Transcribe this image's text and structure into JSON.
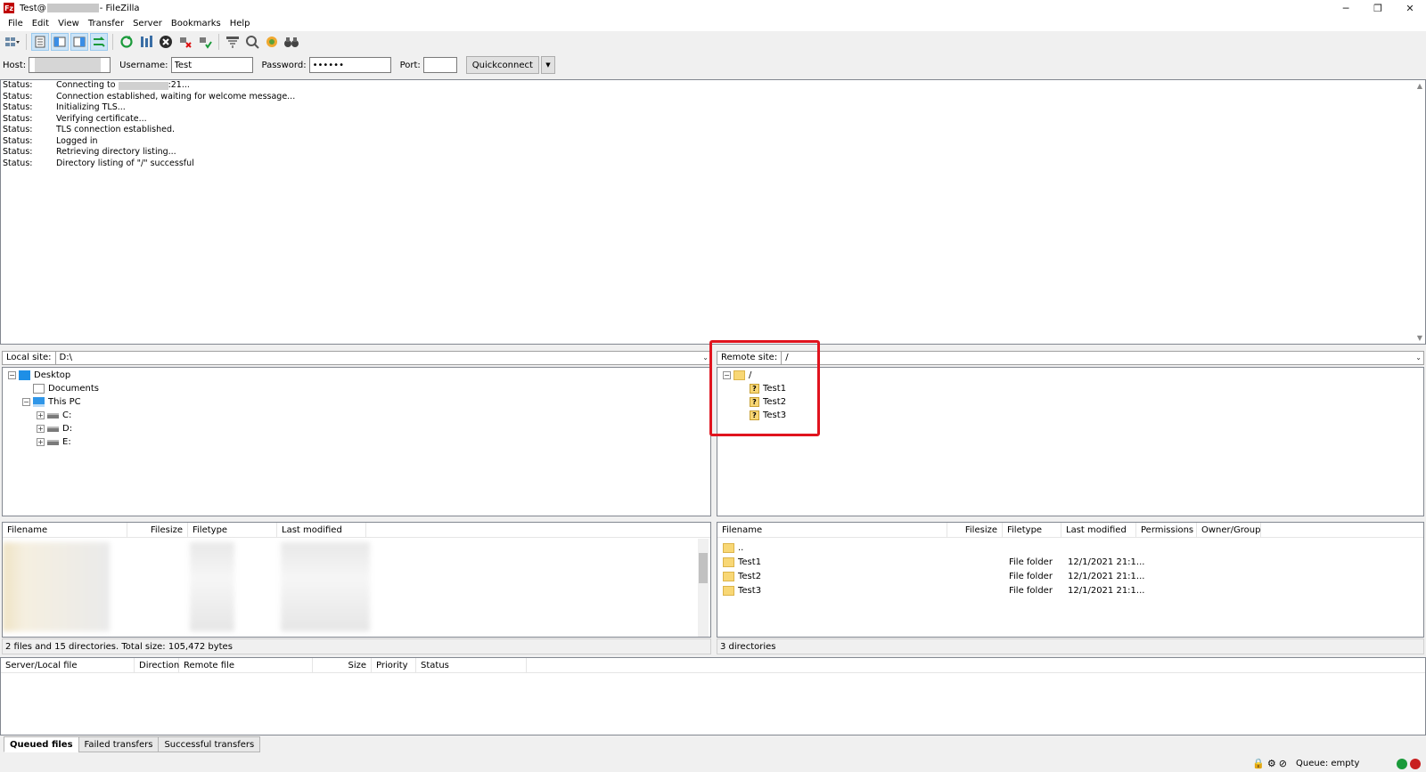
{
  "window": {
    "title_prefix": "Test@",
    "title_suffix": "- FileZilla",
    "app_logo": "Fz",
    "controls": [
      "─",
      "❐",
      "✕"
    ]
  },
  "menu": [
    "File",
    "Edit",
    "View",
    "Transfer",
    "Server",
    "Bookmarks",
    "Help"
  ],
  "quickconnect": {
    "host_label": "Host:",
    "host_value": "",
    "username_label": "Username:",
    "username_value": "Test",
    "password_label": "Password:",
    "password_value": "••••••",
    "port_label": "Port:",
    "port_value": "",
    "button_label": "Quickconnect"
  },
  "log": [
    {
      "type": "Status:",
      "message": "Connecting to",
      "tail": ":21..."
    },
    {
      "type": "Status:",
      "message": "Connection established, waiting for welcome message..."
    },
    {
      "type": "Status:",
      "message": "Initializing TLS..."
    },
    {
      "type": "Status:",
      "message": "Verifying certificate..."
    },
    {
      "type": "Status:",
      "message": "TLS connection established."
    },
    {
      "type": "Status:",
      "message": "Logged in"
    },
    {
      "type": "Status:",
      "message": "Retrieving directory listing..."
    },
    {
      "type": "Status:",
      "message": "Directory listing of \"/\" successful"
    }
  ],
  "local": {
    "site_label": "Local site:",
    "path": "D:\\",
    "tree": [
      {
        "label": "Desktop",
        "icon": "desktop-icon",
        "level": 0,
        "expander": "−"
      },
      {
        "label": "Documents",
        "icon": "document-icon",
        "level": 1,
        "expander": ""
      },
      {
        "label": "This PC",
        "icon": "computer-icon",
        "level": 1,
        "expander": "−"
      },
      {
        "label": "C:",
        "icon": "drive-icon",
        "level": 2,
        "expander": "+"
      },
      {
        "label": "D:",
        "icon": "drive-icon",
        "level": 2,
        "expander": "+"
      },
      {
        "label": "E:",
        "icon": "drive-icon",
        "level": 2,
        "expander": "+"
      }
    ],
    "columns": [
      "Filename",
      "Filesize",
      "Filetype",
      "Last modified"
    ],
    "status": "2 files and 15 directories. Total size: 105,472 bytes"
  },
  "remote": {
    "site_label": "Remote site:",
    "path": "/",
    "tree": [
      {
        "label": "/",
        "icon": "folder-icon",
        "level": 0,
        "expander": "−"
      },
      {
        "label": "Test1",
        "icon": "unknown-folder-icon",
        "level": 1
      },
      {
        "label": "Test2",
        "icon": "unknown-folder-icon",
        "level": 1
      },
      {
        "label": "Test3",
        "icon": "unknown-folder-icon",
        "level": 1
      }
    ],
    "columns": [
      "Filename",
      "Filesize",
      "Filetype",
      "Last modified",
      "Permissions",
      "Owner/Group"
    ],
    "files": [
      {
        "name": "..",
        "size": "",
        "type": "",
        "modified": ""
      },
      {
        "name": "Test1",
        "size": "",
        "type": "File folder",
        "modified": "12/1/2021 21:1..."
      },
      {
        "name": "Test2",
        "size": "",
        "type": "File folder",
        "modified": "12/1/2021 21:1..."
      },
      {
        "name": "Test3",
        "size": "",
        "type": "File folder",
        "modified": "12/1/2021 21:1..."
      }
    ],
    "status": "3 directories"
  },
  "queue": {
    "columns": [
      "Server/Local file",
      "Direction",
      "Remote file",
      "Size",
      "Priority",
      "Status"
    ],
    "tabs": [
      "Queued files",
      "Failed transfers",
      "Successful transfers"
    ],
    "active_tab": 0
  },
  "statusbar": {
    "queue_text": "Queue: empty"
  },
  "colors": {
    "highlight": "#e0141e",
    "accent": "#0078d7"
  }
}
